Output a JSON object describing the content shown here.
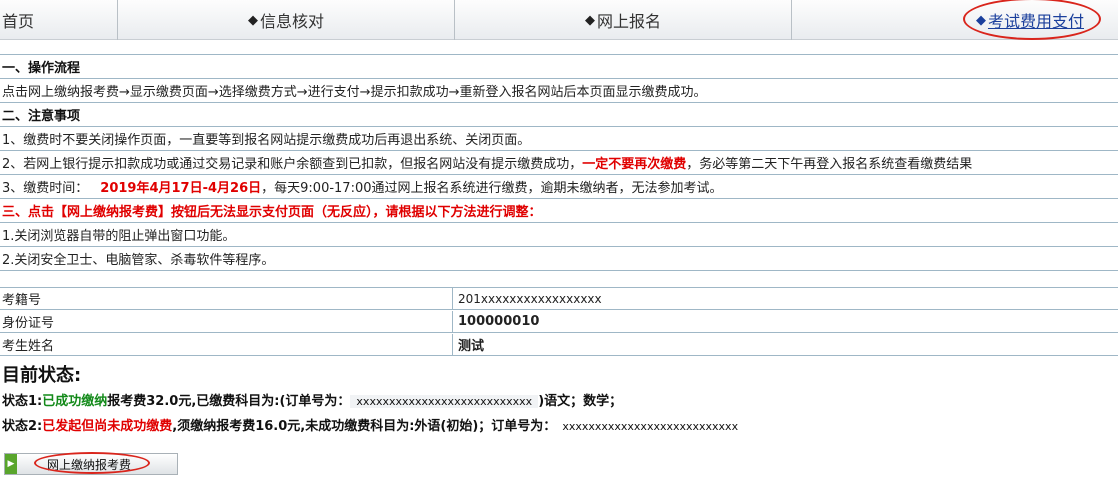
{
  "nav": {
    "home": "首页",
    "verify": "信息核对",
    "register": "网上报名",
    "payment": "考试费用支付",
    "diamond": "◆"
  },
  "section1": {
    "title": "一、操作流程",
    "text": "点击网上缴纳报考费→显示缴费页面→选择缴费方式→进行支付→提示扣款成功→重新登入报名网站后本页面显示缴费成功。"
  },
  "section2": {
    "title": "二、注意事项",
    "item1": "1、缴费时不要关闭操作页面，一直要等到报名网站提示缴费成功后再退出系统、关闭页面。",
    "item2_pre": "2、若网上银行提示扣款成功或通过交易记录和账户余额查到已扣款，但报名网站没有提示缴费成功，",
    "item2_warn": "一定不要再次缴费",
    "item2_post": "，务必等第二天下午再登入报名系统查看缴费结果",
    "item3_pre": "3、缴费时间：",
    "item3_dates": "2019年4月17日-4月26日",
    "item3_post": "，每天9:00-17:00通过网上报名系统进行缴费，逾期未缴纳者，无法参加考试。"
  },
  "section3": {
    "title": "三、点击【网上缴纳报考费】按钮后无法显示支付页面（无反应），请根据以下方法进行调整：",
    "item1": "1.关闭浏览器自带的阻止弹出窗口功能。",
    "item2": "2.关闭安全卫士、电脑管家、杀毒软件等程序。"
  },
  "candidate": {
    "id_label": "考籍号",
    "id_value": "201xxxxxxxxxxxxxxxxx",
    "idcard_label": "身份证号",
    "idcard_value": "100000010",
    "name_label": "考生姓名",
    "name_value": "测试"
  },
  "status": {
    "title": "目前状态:",
    "s1_label": "状态1:",
    "s1_state": "已成功缴纳",
    "s1_text": "报考费32.0元,已缴费科目为:(订单号为：",
    "s1_order": "xxxxxxxxxxxxxxxxxxxxxxxxxxx",
    "s1_tail": ")语文；数学；",
    "s2_label": "状态2:",
    "s2_state": "已发起但尚未成功缴费",
    "s2_text": ",须缴纳报考费16.0元,未成功缴费科目为:外语(初始)；订单号为：",
    "s2_order": "xxxxxxxxxxxxxxxxxxxxxxxxxxx"
  },
  "pay_button": {
    "label": "网上缴纳报考费",
    "icon": "arrow-right-icon"
  },
  "colors": {
    "warning_red": "#e00000",
    "success_green": "#138a1a",
    "link_blue": "#1a3f9c",
    "highlight_circle": "#d9251c"
  }
}
